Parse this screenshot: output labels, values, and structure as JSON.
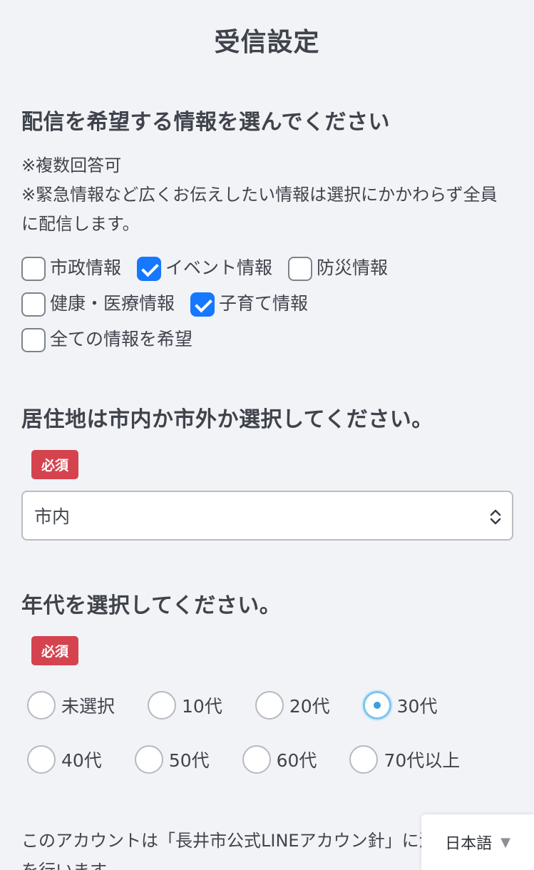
{
  "header": {
    "title": "受信設定"
  },
  "delivery": {
    "heading": "配信を希望する情報を選んでください",
    "notes": [
      "※複数回答可",
      "※緊急情報など広くお伝えしたい情報は選択にかかわらず全員に配信します。"
    ],
    "options": [
      {
        "label": "市政情報",
        "checked": false
      },
      {
        "label": "イベント情報",
        "checked": true
      },
      {
        "label": "防災情報",
        "checked": false
      },
      {
        "label": "健康・医療情報",
        "checked": false
      },
      {
        "label": "子育て情報",
        "checked": true
      },
      {
        "label": "全ての情報を希望",
        "checked": false
      }
    ]
  },
  "residence": {
    "heading": "居住地は市内か市外か選択してください。",
    "required_label": "必須",
    "selected_value": "市内"
  },
  "age": {
    "heading": "年代を選択してください。",
    "required_label": "必須",
    "options": [
      "未選択",
      "10代",
      "20代",
      "30代",
      "40代",
      "50代",
      "60代",
      "70代以上"
    ],
    "selected": "30代"
  },
  "footer": {
    "text": "このアカウントは「長井市公式LINEアカウン針」に沿った運用を行います"
  },
  "language": {
    "label": "日本語",
    "arrow": "▼"
  },
  "colors": {
    "accent": "#1677ff",
    "required": "#d5434e",
    "radio_selected": "#3aa0e0"
  }
}
